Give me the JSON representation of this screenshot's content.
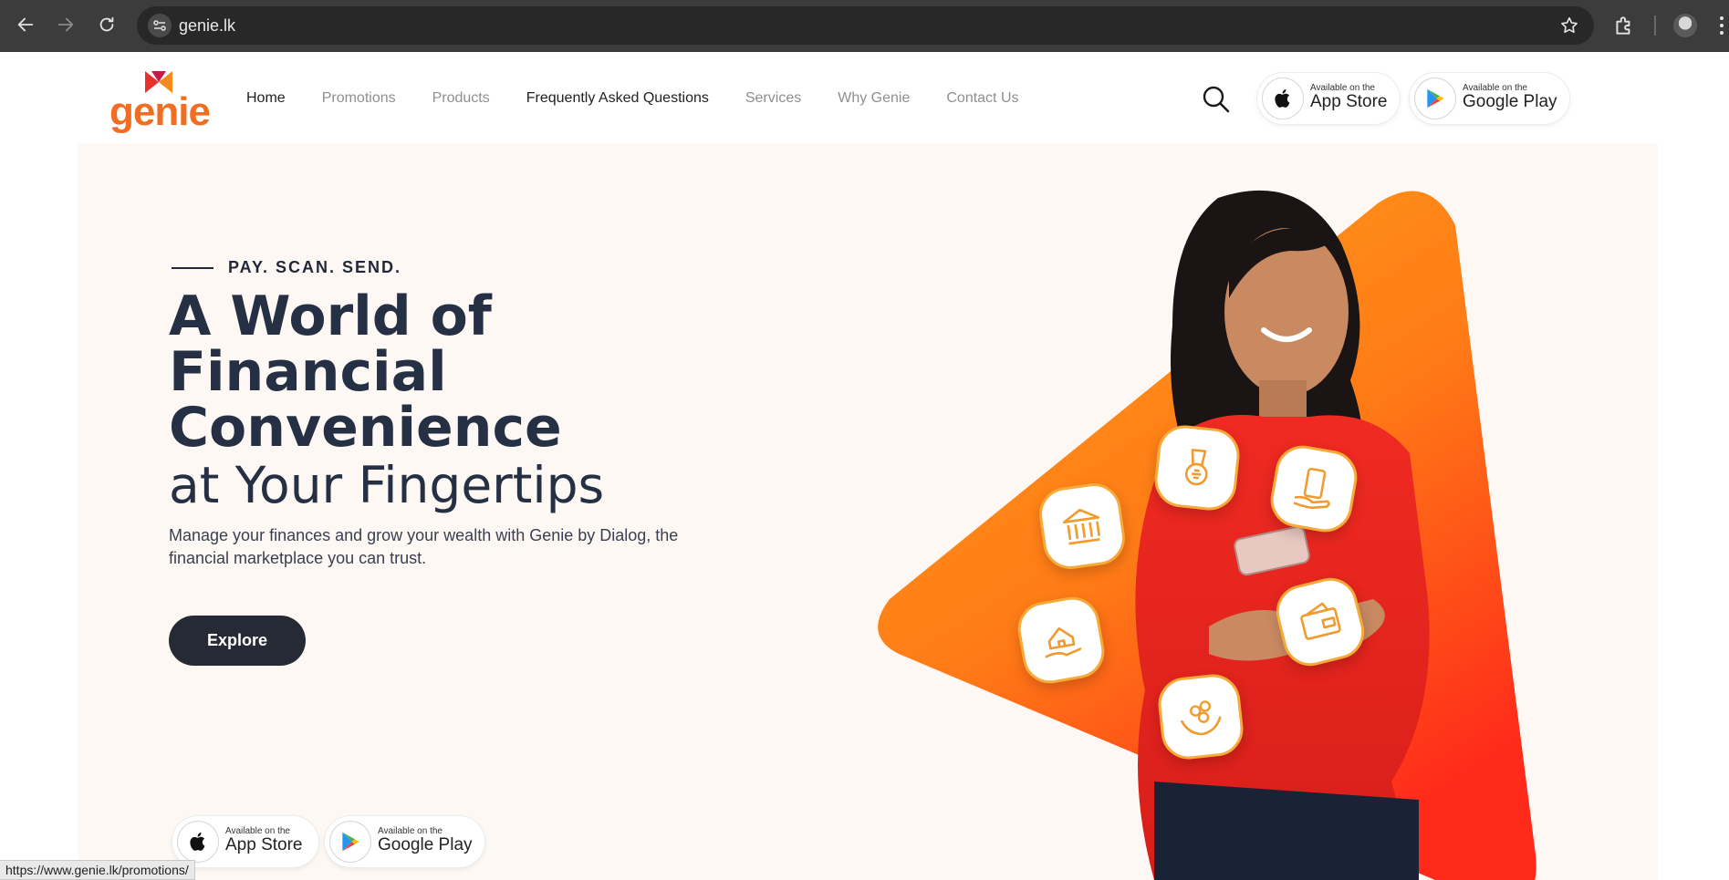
{
  "browser": {
    "url": "genie.lk",
    "status_url": "https://www.genie.lk/promotions/"
  },
  "header": {
    "logo_text": "genie",
    "nav": [
      {
        "label": "Home"
      },
      {
        "label": "Promotions"
      },
      {
        "label": "Products"
      },
      {
        "label": "Frequently Asked Questions"
      },
      {
        "label": "Services"
      },
      {
        "label": "Why Genie"
      },
      {
        "label": "Contact Us"
      }
    ],
    "app_store": {
      "small": "Available on the",
      "big": "App Store"
    },
    "google_play": {
      "small": "Available on the",
      "big": "Google Play"
    }
  },
  "hero": {
    "eyebrow": "PAY. SCAN. SEND.",
    "headline_line1": "A World of",
    "headline_line2": "Financial",
    "headline_line3": "Convenience",
    "headline_line4": "at Your Fingertips",
    "description": "Manage your finances and grow your wealth with Genie by Dialog, the financial marketplace you can trust.",
    "cta": "Explore",
    "app_store": {
      "small": "Available on the",
      "big": "App Store"
    },
    "google_play": {
      "small": "Available on the",
      "big": "Google Play"
    }
  },
  "colors": {
    "brand_orange": "#f26c21",
    "dark_navy": "#263045",
    "hero_bg": "#fdf8f3",
    "icon_accent": "#f7a93a"
  }
}
